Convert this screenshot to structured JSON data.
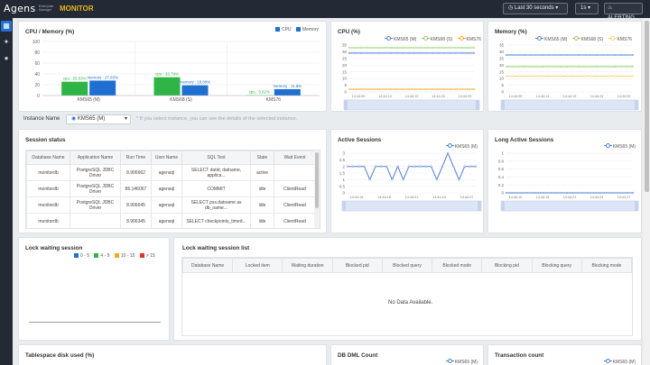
{
  "header": {
    "logo_text": "Agens",
    "logo_sub": "Enterprise Manager",
    "product": "MONITOR",
    "time_range": "Last 30 seconds",
    "interval": "1s",
    "alerting": "ALERTING"
  },
  "sidebar": [
    {
      "icon": "dashboard-grid-icon"
    },
    {
      "icon": "topology-icon"
    },
    {
      "icon": "alert-bell-icon"
    }
  ],
  "cpu_memory": {
    "title": "CPU / Memory (%)",
    "legend": [
      "CPU",
      "Memory"
    ],
    "colors": {
      "cpu": "#2fb546",
      "memory": "#1f6fd0"
    }
  },
  "cpu_panel": {
    "title": "CPU (%)",
    "legend": [
      "KMS65 (M)",
      "KMS68 (S)",
      "KMS76"
    ]
  },
  "mem_panel": {
    "title": "Memory (%)",
    "legend": [
      "KMS65 (M)",
      "KMS68 (S)",
      "KMS76"
    ]
  },
  "instance": {
    "label": "Instance Name",
    "selected": "KMS65 (M)",
    "hint": "* If you select instance, you can see the details of the selected instance."
  },
  "session_status": {
    "title": "Session status",
    "columns": [
      "Database Name",
      "Application Name",
      "Run Time",
      "User Name",
      "SQL Text",
      "State",
      "Wait Event"
    ],
    "rows": [
      [
        "monitordb",
        "PostgreSQL JDBC Driver",
        "8.906662",
        "agensql",
        "SELECT datid, datname, applica...",
        "active",
        ""
      ],
      [
        "monitordb",
        "PostgreSQL JDBC Driver",
        "86.146067",
        "agensql",
        "COMMIT",
        "idle",
        "ClientRead"
      ],
      [
        "monitordb",
        "PostgreSQL JDBC Driver",
        "8.906645",
        "agensql",
        "SELECT pss.datname as db_name...",
        "idle",
        "ClientRead"
      ],
      [
        "monitordb",
        "",
        "8.906345",
        "agensql",
        "SELECT checkpoints_timed...",
        "idle",
        "ClientRead"
      ]
    ]
  },
  "active_sessions": {
    "title": "Active Sessions",
    "legend": "KMS65 (M)"
  },
  "long_active_sessions": {
    "title": "Long Active Sessions",
    "legend": "KMS65 (M)"
  },
  "lock_waiting": {
    "title": "Lock waiting session",
    "legend": [
      {
        "label": "0 - 5",
        "color": "#1f6fd0"
      },
      {
        "label": "4 - 9",
        "color": "#2fb546"
      },
      {
        "label": "10 - 15",
        "color": "#f3a722"
      },
      {
        "label": "> 15",
        "color": "#e0352b"
      }
    ]
  },
  "lock_list": {
    "title": "Lock waiting session list",
    "columns": [
      "Database Name",
      "Locked item",
      "Waiting duration",
      "Blocked pid",
      "Blocked query",
      "Blocked mode",
      "Blocking pid",
      "Blocking query",
      "Blocking mode"
    ],
    "empty": "No Data Available."
  },
  "bottom": {
    "tablespace_title": "Tablespace disk used (%)",
    "dml_title": "DB DML Count",
    "dml_legend": "KMS65 (M)",
    "tx_title": "Transaction count",
    "tx_legend": "KMS65 (M)"
  },
  "chart_data": [
    {
      "type": "bar",
      "title": "CPU / Memory (%)",
      "categories": [
        "KMS65 (M)",
        "KMS68 (S)",
        "KMS76"
      ],
      "series": [
        {
          "name": "CPU",
          "values": [
            25.53,
            33.79,
            0.62
          ],
          "labels": [
            "cpu : 25.53%",
            "cpu : 33.79%",
            "cpu : 0.62%"
          ]
        },
        {
          "name": "Memory",
          "values": [
            27.63,
            18.89,
            11.8
          ],
          "labels": [
            "memory : 27.63%",
            "memory : 18.89%",
            "memory : 11.8%"
          ]
        }
      ],
      "ylim": [
        0,
        100
      ],
      "yticks": [
        0,
        20,
        40,
        60,
        80,
        100
      ],
      "grid": true,
      "legend_position": "top-right"
    },
    {
      "type": "line",
      "title": "CPU (%)",
      "x": [
        "14:44:09",
        "14:44:14",
        "14:44:19",
        "14:44:24",
        "14:44:29"
      ],
      "series": [
        {
          "name": "KMS65 (M)",
          "values": [
            29,
            29,
            29,
            29,
            29,
            29,
            29,
            29,
            29,
            29,
            29,
            29,
            29,
            29,
            29,
            29,
            29,
            29,
            29,
            29,
            29,
            29
          ],
          "color": "#4e7fd0"
        },
        {
          "name": "KMS68 (S)",
          "values": [
            33,
            33,
            33,
            33,
            33,
            33,
            33,
            33,
            33,
            33,
            33,
            33,
            33,
            33,
            33,
            33,
            33,
            33,
            33,
            33,
            33,
            33
          ],
          "color": "#8fd068"
        },
        {
          "name": "KMS76",
          "values": [
            2,
            2,
            2,
            2,
            2,
            2,
            2,
            2,
            2,
            2,
            2,
            2,
            2,
            2,
            2,
            2,
            2,
            2,
            2,
            2,
            2,
            2
          ],
          "color": "#f3a722"
        }
      ],
      "ylim": [
        0,
        35
      ],
      "yticks": [
        0,
        5,
        10,
        15,
        20,
        25,
        30,
        35
      ],
      "grid": true,
      "legend_position": "top-right"
    },
    {
      "type": "line",
      "title": "Memory (%)",
      "x": [
        "14:44:09",
        "14:44:14",
        "14:44:19",
        "14:44:24",
        "14:44:29"
      ],
      "series": [
        {
          "name": "KMS65 (M)",
          "values": [
            27.6,
            27.6,
            27.6,
            27.6,
            27.6,
            27.6,
            27.6,
            27.6,
            27.6,
            27.6,
            27.6,
            27.6,
            27.6,
            27.6,
            27.6,
            27.6,
            27.6,
            27.6,
            27.6,
            27.6,
            27.6,
            27.6
          ],
          "color": "#4e7fd0"
        },
        {
          "name": "KMS68 (S)",
          "values": [
            18.9,
            18.9,
            18.9,
            18.9,
            18.9,
            18.9,
            18.9,
            18.9,
            18.9,
            18.9,
            18.9,
            18.9,
            18.9,
            18.9,
            18.9,
            18.9,
            18.9,
            18.9,
            18.9,
            18.9,
            18.9,
            18.9
          ],
          "color": "#8fd068"
        },
        {
          "name": "KMS76",
          "values": [
            11.8,
            11.8,
            11.8,
            11.8,
            11.8,
            11.8,
            11.8,
            11.8,
            11.8,
            11.8,
            11.8,
            11.8,
            11.8,
            11.8,
            11.8,
            11.8,
            11.8,
            11.8,
            11.8,
            11.8,
            11.8,
            11.8
          ],
          "color": "#f3d36a"
        }
      ],
      "ylim": [
        0,
        35
      ],
      "yticks": [
        0,
        5,
        10,
        15,
        20,
        25,
        30,
        35
      ],
      "grid": true,
      "legend_position": "top-right"
    },
    {
      "type": "line",
      "title": "Active Sessions",
      "x": [
        "14:44:15",
        "14:44:18",
        "14:44:21",
        "14:44:24",
        "14:44:27"
      ],
      "series": [
        {
          "name": "KMS65 (M)",
          "values": [
            2,
            2,
            2,
            2,
            1,
            2,
            2,
            2,
            1,
            2,
            1,
            2,
            2,
            2,
            2,
            2,
            1,
            2,
            3,
            2,
            1,
            2,
            2,
            2
          ],
          "color": "#4e7fd0"
        }
      ],
      "ylim": [
        0,
        3
      ],
      "yticks": [
        0,
        0.5,
        1,
        1.5,
        2,
        2.5,
        3
      ],
      "grid": true,
      "legend_position": "top-right"
    },
    {
      "type": "line",
      "title": "Long Active Sessions",
      "x": [
        "14:44:15",
        "14:44:18",
        "14:44:21",
        "14:44:24",
        "14:44:27"
      ],
      "series": [
        {
          "name": "KMS65 (M)",
          "values": [
            0,
            0,
            0,
            0,
            0,
            0,
            0,
            0,
            0,
            0,
            0,
            0,
            0,
            0,
            0,
            0,
            0,
            0,
            0,
            0,
            0,
            0,
            0,
            0
          ],
          "color": "#4e7fd0"
        }
      ],
      "ylim": [
        0,
        1
      ],
      "yticks": [
        0,
        0.2,
        0.4,
        0.6,
        0.8,
        1
      ],
      "grid": true,
      "legend_position": "top-right"
    }
  ]
}
